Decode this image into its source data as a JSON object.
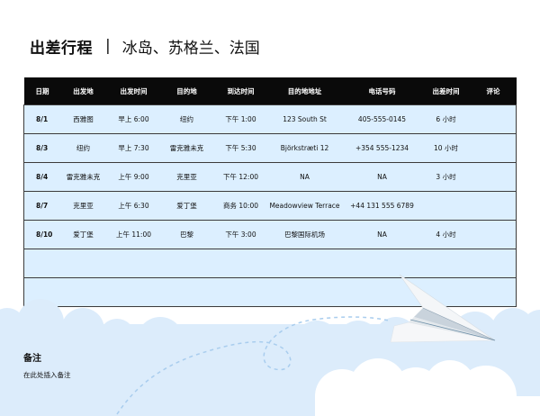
{
  "header": {
    "title": "出差行程",
    "separator": "|",
    "subtitle": "冰岛、苏格兰、法国"
  },
  "table": {
    "columns": [
      "日期",
      "出发地",
      "出发时间",
      "目的地",
      "到达时间",
      "目的地地址",
      "电话号码",
      "出差时间",
      "评论"
    ],
    "rows": [
      [
        "8/1",
        "西雅图",
        "早上 6:00",
        "纽约",
        "下午 1:00",
        "123 South St",
        "405-555-0145",
        "6 小时",
        ""
      ],
      [
        "8/3",
        "纽约",
        "早上 7:30",
        "雷克雅未克",
        "下午 5:30",
        "Björkstræti 12",
        "+354 555-1234",
        "10 小时",
        ""
      ],
      [
        "8/4",
        "雷克雅未克",
        "上午 9:00",
        "克里亚",
        "下午 12:00",
        "NA",
        "NA",
        "3 小时",
        ""
      ],
      [
        "8/7",
        "克里亚",
        "上午 6:30",
        "爱丁堡",
        "商务 10:00",
        "Meadowview Terrace",
        "+44 131 555 6789",
        "",
        ""
      ],
      [
        "8/10",
        "爱丁堡",
        "上午 11:00",
        "巴黎",
        "下午 3:00",
        "巴黎国际机场",
        "NA",
        "4 小时",
        ""
      ],
      [
        "",
        "",
        "",
        "",
        "",
        "",
        "",
        "",
        ""
      ],
      [
        "",
        "",
        "",
        "",
        "",
        "",
        "",
        "",
        ""
      ]
    ]
  },
  "notes": {
    "title": "备注",
    "body": "在此处插入备注"
  },
  "colors": {
    "header_bg": "#0a0a0a",
    "row_bg": "#dcefff",
    "cloud": "#dcecfb",
    "dash": "#a9cdee"
  }
}
